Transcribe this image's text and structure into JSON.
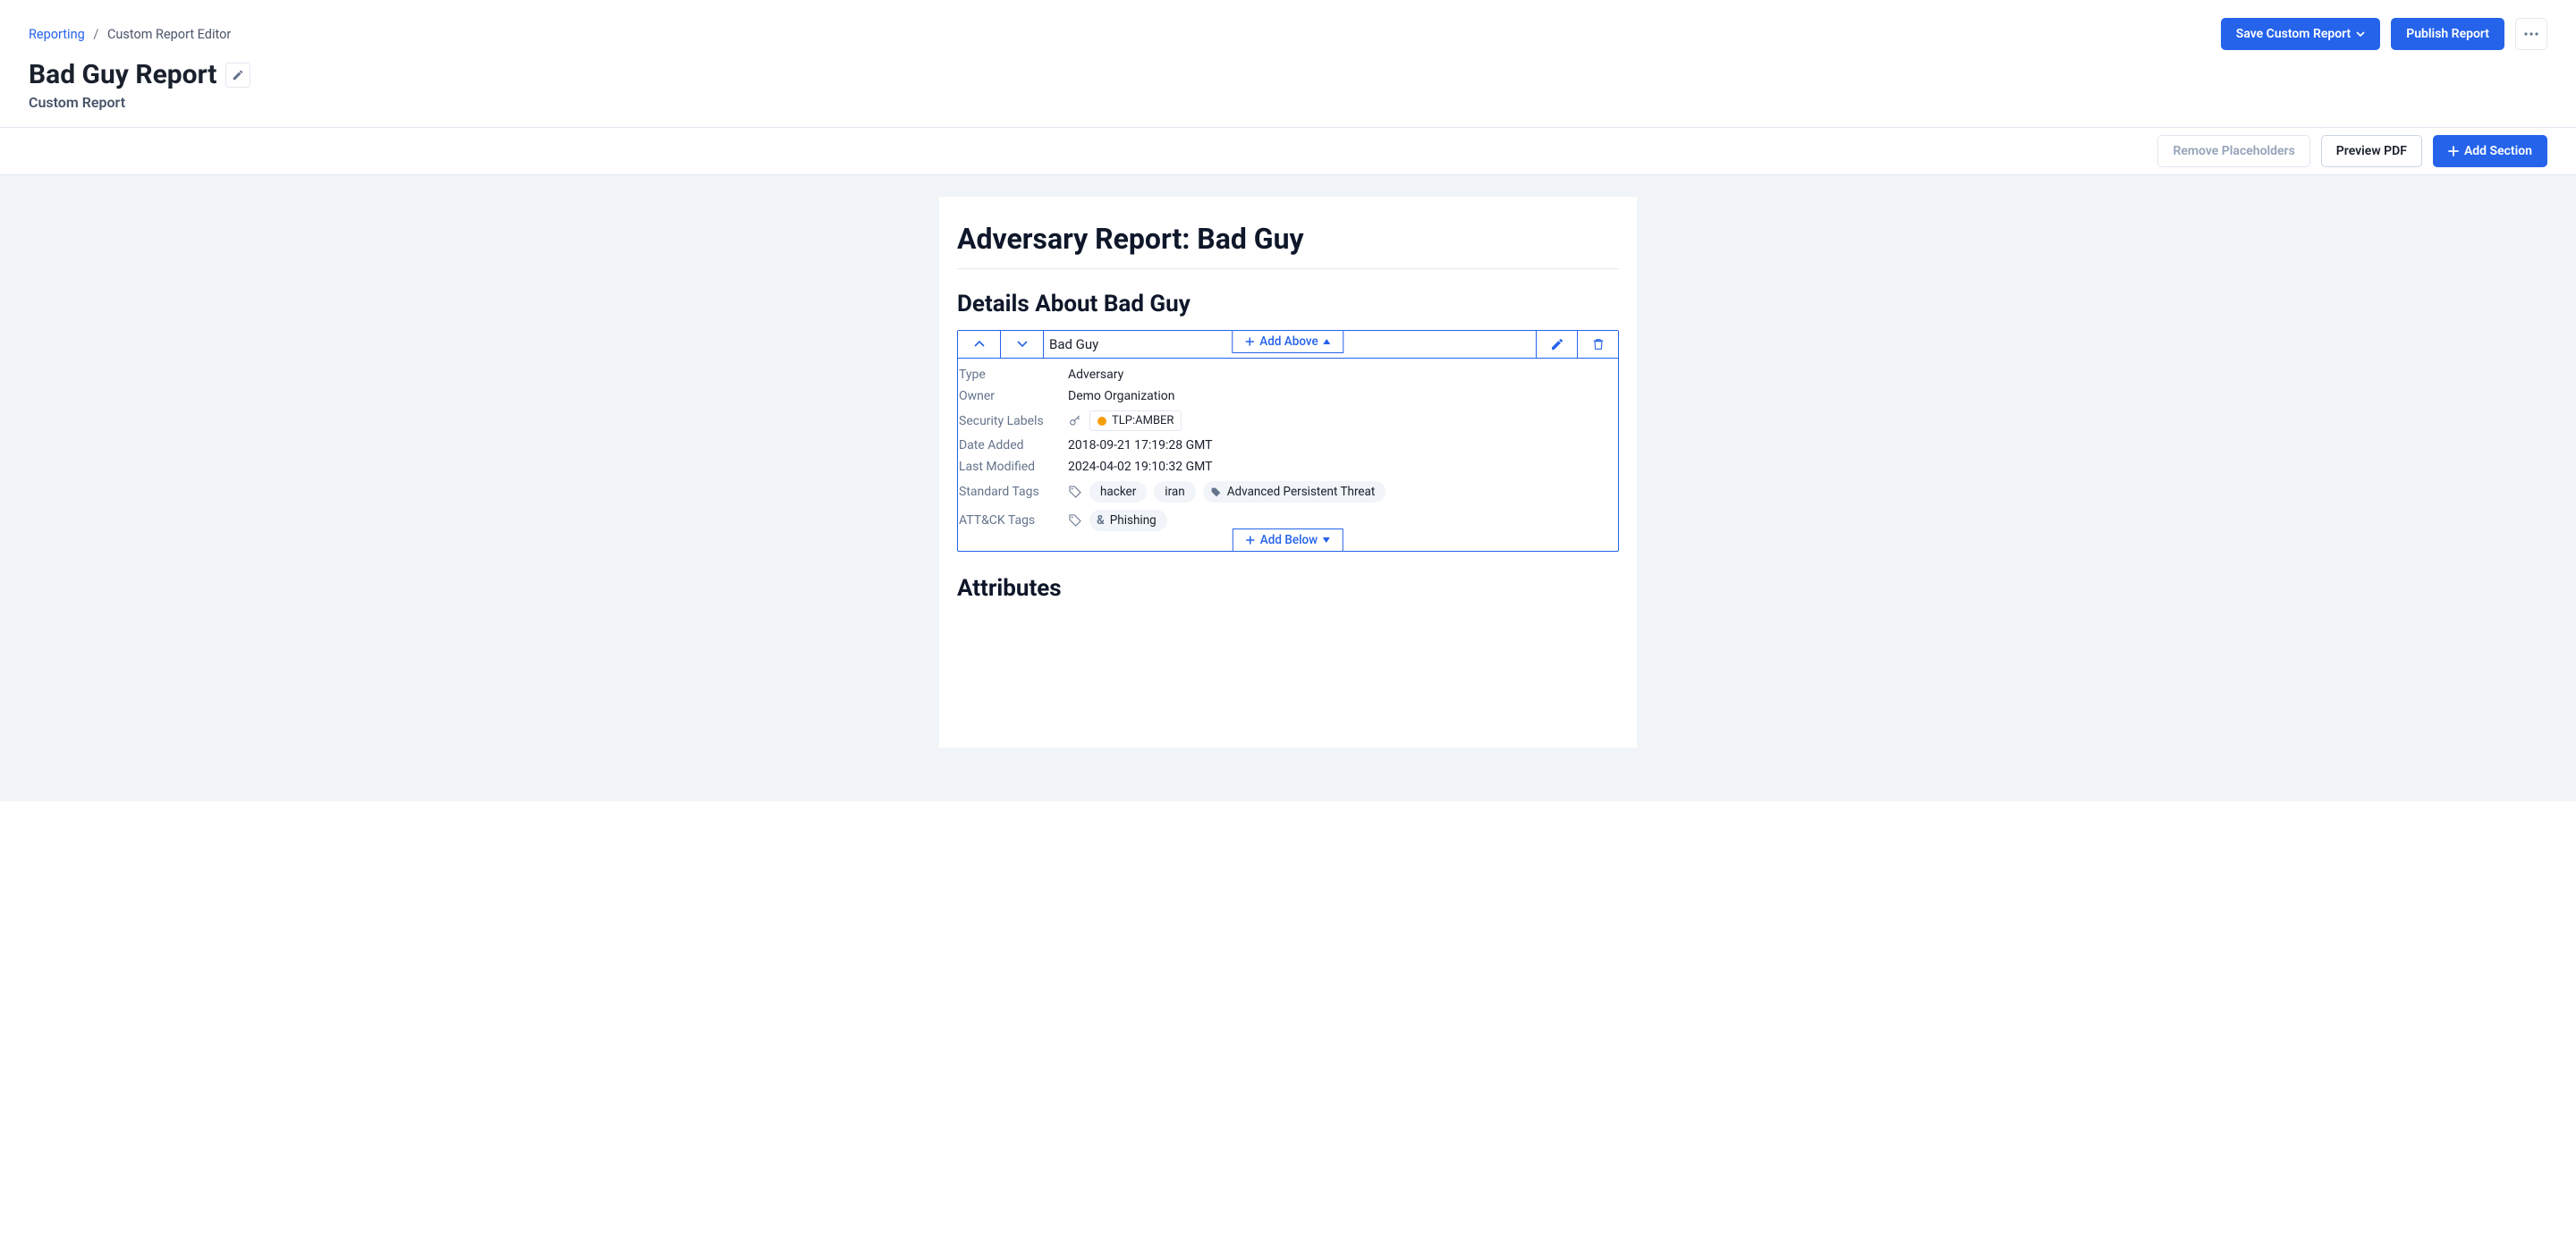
{
  "breadcrumb": {
    "root": "Reporting",
    "current": "Custom Report Editor"
  },
  "header": {
    "save_label": "Save Custom Report",
    "publish_label": "Publish Report"
  },
  "page": {
    "title": "Bad Guy Report",
    "subtitle": "Custom Report"
  },
  "toolbar": {
    "remove_placeholders": "Remove Placeholders",
    "preview_pdf": "Preview PDF",
    "add_section": "Add Section"
  },
  "doc": {
    "report_title": "Adversary Report: Bad Guy",
    "details_heading": "Details About Bad Guy",
    "section_name": "Bad Guy",
    "add_above": "Add Above",
    "add_below": "Add Below",
    "labels": {
      "type": "Type",
      "owner": "Owner",
      "security_labels": "Security Labels",
      "date_added": "Date Added",
      "last_modified": "Last Modified",
      "standard_tags": "Standard Tags",
      "attack_tags": "ATT&CK Tags"
    },
    "values": {
      "type": "Adversary",
      "owner": "Demo Organization",
      "tlp": "TLP:AMBER",
      "date_added": "2018-09-21 17:19:28 GMT",
      "last_modified": "2024-04-02 19:10:32 GMT",
      "tags": {
        "t0": "hacker",
        "t1": "iran",
        "t2": "Advanced Persistent Threat"
      },
      "attack_tags": {
        "a0": "Phishing"
      }
    },
    "attributes_heading": "Attributes"
  }
}
